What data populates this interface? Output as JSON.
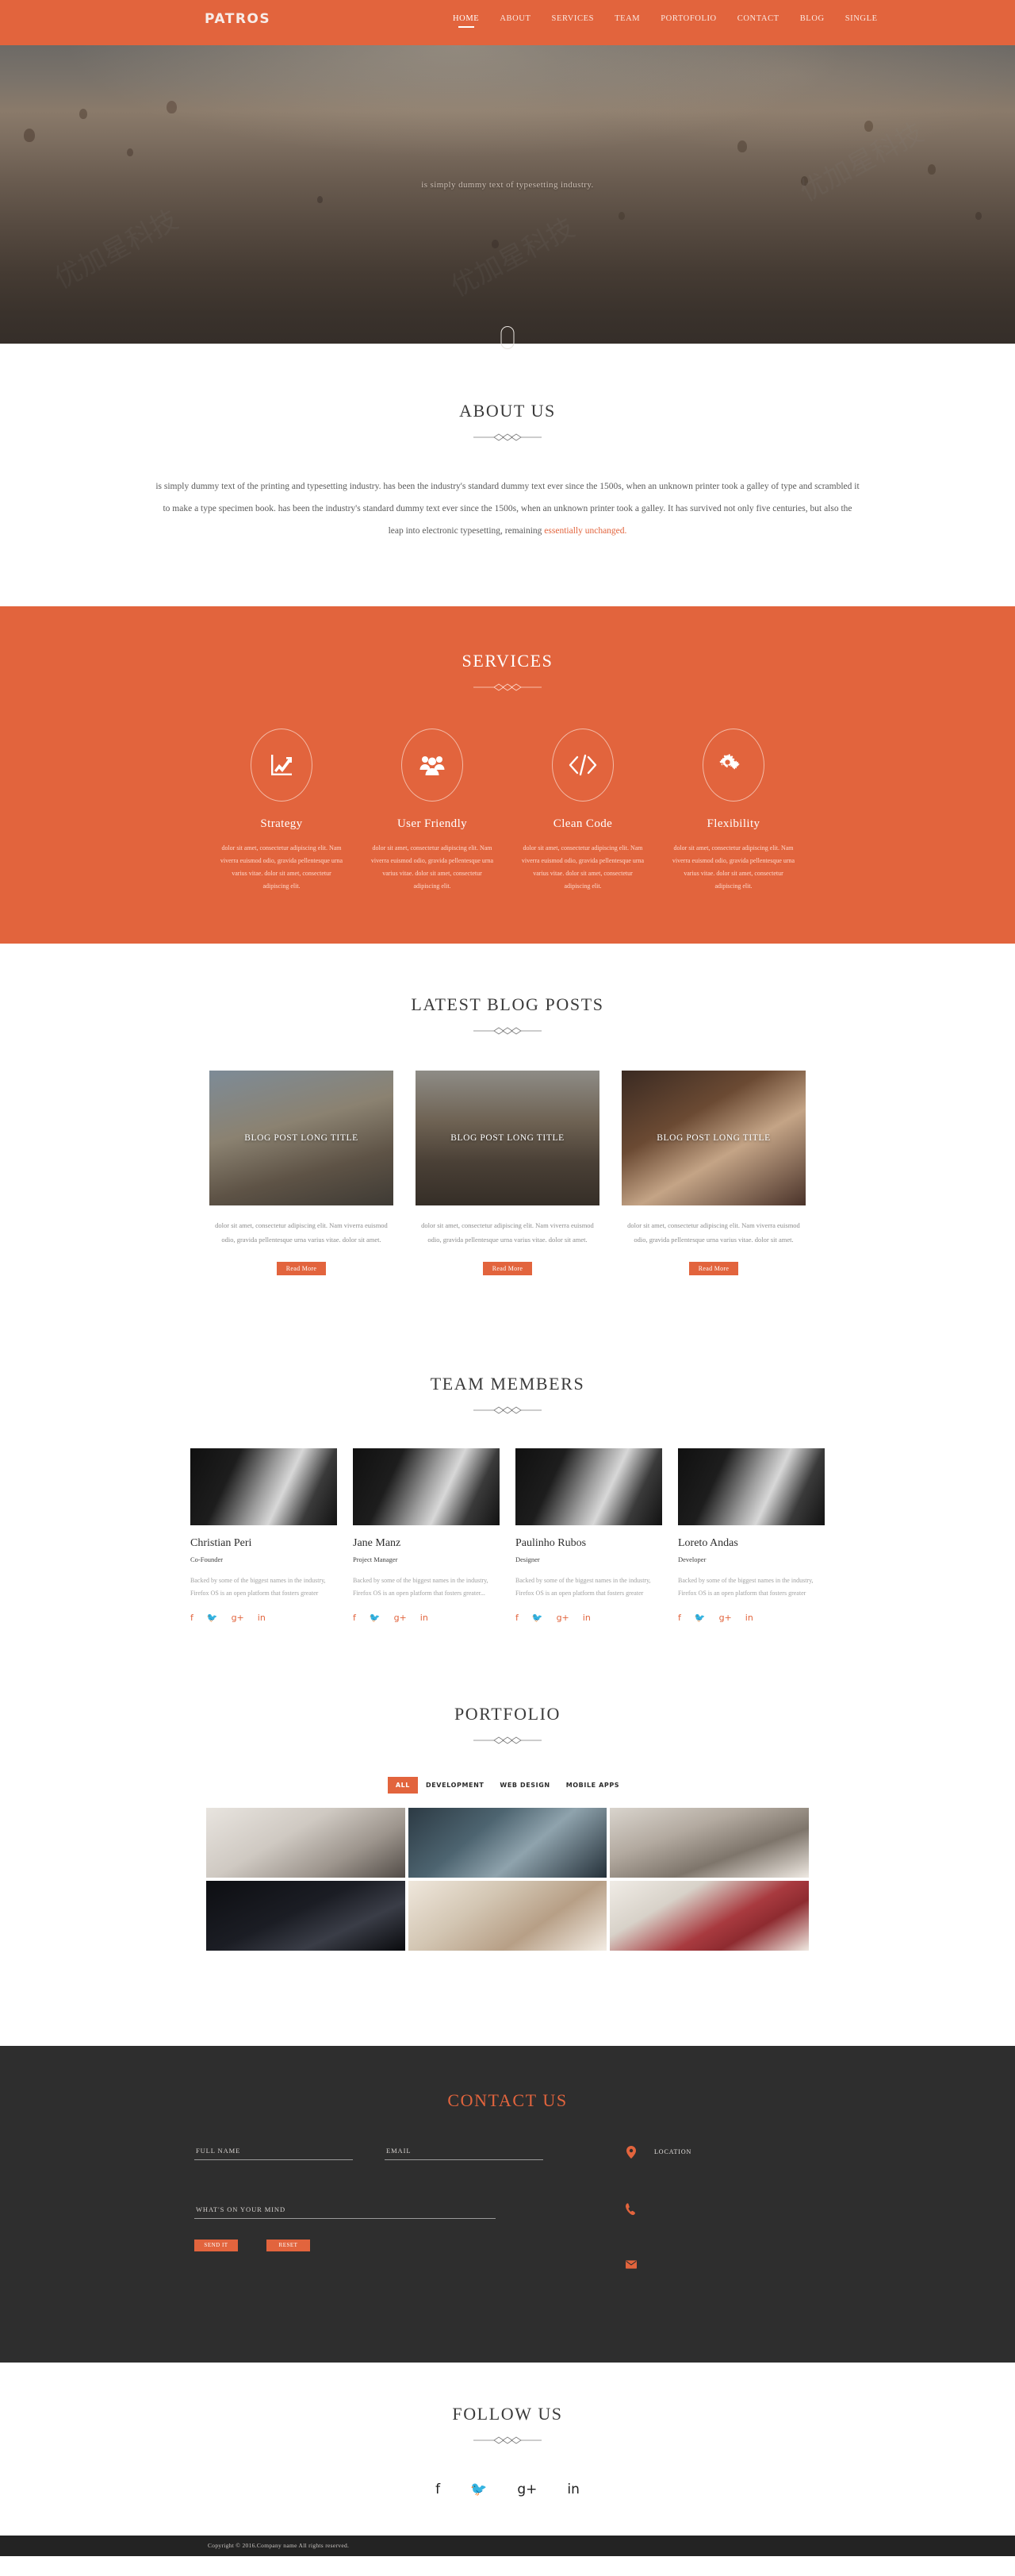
{
  "header": {
    "brand": "PATROS",
    "nav": [
      {
        "label": "HOME",
        "active": true
      },
      {
        "label": "ABOUT",
        "active": false
      },
      {
        "label": "SERVICES",
        "active": false
      },
      {
        "label": "TEAM",
        "active": false
      },
      {
        "label": "PORTOFOLIO",
        "active": false
      },
      {
        "label": "CONTACT",
        "active": false
      },
      {
        "label": "BLOG",
        "active": false
      },
      {
        "label": "SINGLE",
        "active": false
      }
    ],
    "accent_color": "#e2643d"
  },
  "hero": {
    "tagline": "is simply dummy text of typesetting industry.",
    "scroll_indicator": "mouse-scroll-icon"
  },
  "about": {
    "title": "ABOUT US",
    "body_1": "is simply dummy text of the printing and typesetting industry. has been the industry's standard dummy text ever since the 1500s, when an unknown printer took a galley of type and scrambled it to make a type specimen book. has been the industry's standard dummy text ever since the 1500s, when an unknown printer took a galley. It has survived not only five centuries, but also the leap into electronic typesetting, remaining ",
    "highlight": "essentially unchanged."
  },
  "services": {
    "title": "SERVICES",
    "items": [
      {
        "icon": "chart-growth-icon",
        "name": "Strategy",
        "desc": "dolor sit amet, consectetur adipiscing elit. Nam viverra euismod odio, gravida pellentesque urna varius vitae. dolor sit amet, consectetur adipiscing elit."
      },
      {
        "icon": "users-group-icon",
        "name": "User Friendly",
        "desc": "dolor sit amet, consectetur adipiscing elit. Nam viverra euismod odio, gravida pellentesque urna varius vitae. dolor sit amet, consectetur adipiscing elit."
      },
      {
        "icon": "code-brackets-icon",
        "name": "Clean Code",
        "desc": "dolor sit amet, consectetur adipiscing elit. Nam viverra euismod odio, gravida pellentesque urna varius vitae. dolor sit amet, consectetur adipiscing elit."
      },
      {
        "icon": "gears-cogs-icon",
        "name": "Flexibility",
        "desc": "dolor sit amet, consectetur adipiscing elit. Nam viverra euismod odio, gravida pellentesque urna varius vitae. dolor sit amet, consectetur adipiscing elit."
      }
    ]
  },
  "blog": {
    "title": "LATEST BLOG POSTS",
    "posts": [
      {
        "title": "BLOG POST LONG TITLE",
        "desc": "dolor sit amet, consectetur adipiscing elit. Nam viverra euismod odio, gravida pellentesque urna varius vitae. dolor sit amet.",
        "button": "Read More"
      },
      {
        "title": "BLOG POST LONG TITLE",
        "desc": "dolor sit amet, consectetur adipiscing elit. Nam viverra euismod odio, gravida pellentesque urna varius vitae. dolor sit amet.",
        "button": "Read More"
      },
      {
        "title": "BLOG POST LONG TITLE",
        "desc": "dolor sit amet, consectetur adipiscing elit. Nam viverra euismod odio, gravida pellentesque urna varius vitae. dolor sit amet.",
        "button": "Read More"
      }
    ]
  },
  "team": {
    "title": "TEAM MEMBERS",
    "members": [
      {
        "name": "Christian Peri",
        "role": "Co-Founder",
        "bio": "Backed by some of the biggest names in the industry, Firefox OS is an open platform that fosters greater"
      },
      {
        "name": "Jane Manz",
        "role": "Project Manager",
        "bio": "Backed by some of the biggest names in the industry, Firefox OS is an open platform that fosters greater..."
      },
      {
        "name": "Paulinho Rubos",
        "role": "Designer",
        "bio": "Backed by some of the biggest names in the industry, Firefox OS is an open platform that fosters greater"
      },
      {
        "name": "Loreto Andas",
        "role": "Developer",
        "bio": "Backed by some of the biggest names in the industry, Firefox OS is an open platform that fosters greater"
      }
    ],
    "social": [
      "facebook-icon",
      "twitter-icon",
      "google-plus-icon",
      "linkedin-icon"
    ]
  },
  "portfolio": {
    "title": "PORTFOLIO",
    "filters": [
      {
        "label": "ALL",
        "active": true
      },
      {
        "label": "DEVELOPMENT",
        "active": false
      },
      {
        "label": "WEB DESIGN",
        "active": false
      },
      {
        "label": "MOBILE APPS",
        "active": false
      }
    ],
    "items": [
      {
        "alt": "desk-speaker-workspace"
      },
      {
        "alt": "hand-holding-device"
      },
      {
        "alt": "hands-on-desk-notes"
      },
      {
        "alt": "dark-game-console"
      },
      {
        "alt": "desk-flatlay-phone-notebook"
      },
      {
        "alt": "raspberries-in-white-cup"
      }
    ]
  },
  "contact": {
    "title": "CONTACT US",
    "fields": {
      "name_placeholder": "FULL NAME",
      "name_value": "",
      "email_placeholder": "EMAIL",
      "email_value": "",
      "message_placeholder": "WHAT'S ON YOUR MIND",
      "message_value": ""
    },
    "send_label": "SEND IT",
    "reset_label": "RESET",
    "info": [
      {
        "icon": "map-pin-icon",
        "label": "LOCATION"
      },
      {
        "icon": "phone-icon",
        "label": ""
      },
      {
        "icon": "envelope-icon",
        "label": ""
      }
    ]
  },
  "follow": {
    "title": "FOLLOW US",
    "social": [
      "facebook-icon",
      "twitter-icon",
      "google-plus-icon",
      "linkedin-icon"
    ]
  },
  "footer": {
    "copyright": "Copyright © 2016.Company name All rights reserved."
  }
}
